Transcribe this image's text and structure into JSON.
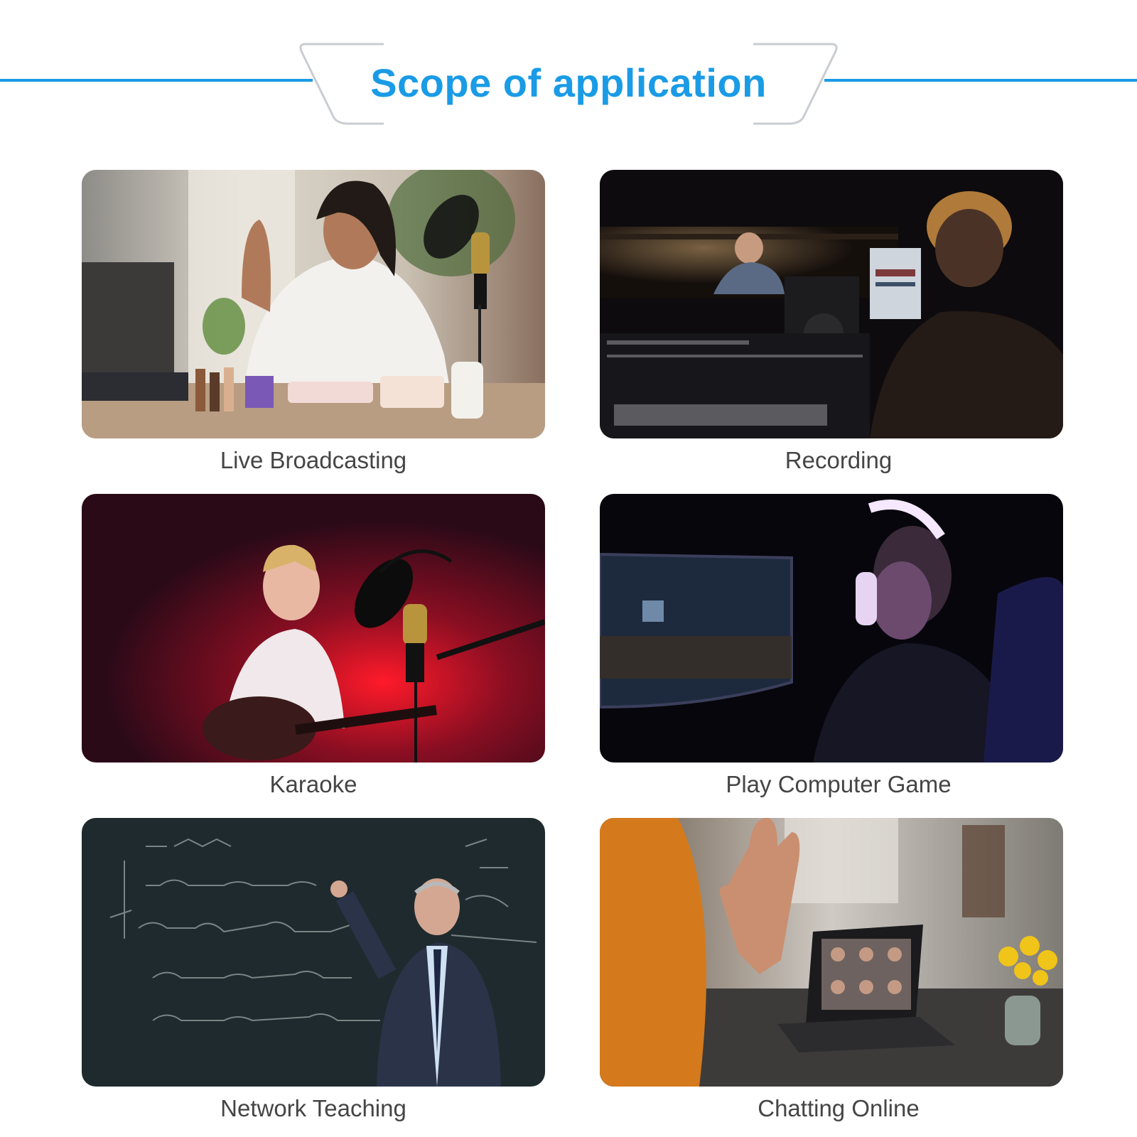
{
  "header": {
    "title": "Scope of application",
    "accent_color": "#1a9be6"
  },
  "cards": [
    {
      "label": "Live Broadcasting",
      "image": "woman-waving-with-microphone-photo"
    },
    {
      "label": "Recording",
      "image": "recording-studio-photo"
    },
    {
      "label": "Karaoke",
      "image": "woman-singing-with-guitar-photo"
    },
    {
      "label": "Play Computer Game",
      "image": "gamer-with-headphones-photo"
    },
    {
      "label": "Network Teaching",
      "image": "teacher-at-chalkboard-photo"
    },
    {
      "label": "Chatting Online",
      "image": "video-call-on-laptop-photo"
    }
  ]
}
